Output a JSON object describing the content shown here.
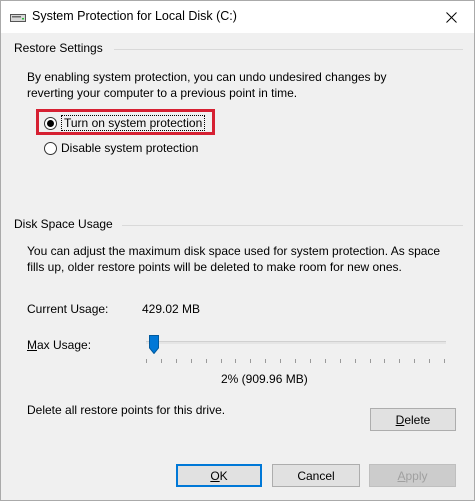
{
  "window": {
    "title": "System Protection for Local Disk (C:)",
    "close_icon": "close-icon"
  },
  "restore_settings": {
    "group_label": "Restore Settings",
    "description_line1": "By enabling system protection, you can undo undesired changes by",
    "description_line2": "reverting your computer to a previous point in time.",
    "options": [
      {
        "label": "Turn on system protection",
        "checked": true
      },
      {
        "label": "Disable system protection",
        "checked": false
      }
    ]
  },
  "disk_space": {
    "group_label": "Disk Space Usage",
    "description_line1": "You can adjust the maximum disk space used for system protection. As space",
    "description_line2": "fills up, older restore points will be deleted to make room for new ones.",
    "current_usage_label": "Current Usage:",
    "current_usage_value": "429.02 MB",
    "max_usage_label": "Max Usage:",
    "max_usage_percent": 2,
    "max_usage_display": "2% (909.96 MB)",
    "delete_text": "Delete all restore points for this drive.",
    "delete_button": "Delete"
  },
  "buttons": {
    "ok": "OK",
    "cancel": "Cancel",
    "apply": "Apply"
  },
  "colors": {
    "highlight": "#d62032",
    "default_button_border": "#0078d7",
    "slider_thumb": "#0078d7"
  }
}
